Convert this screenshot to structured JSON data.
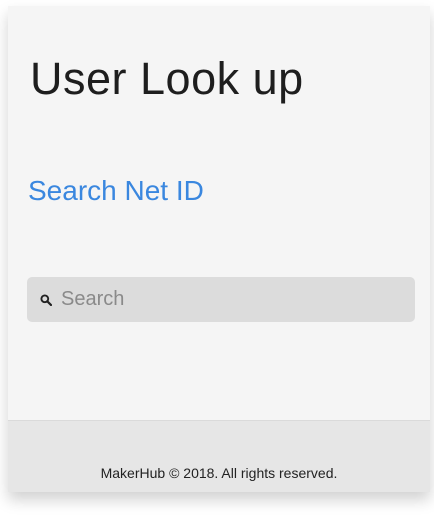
{
  "header": {
    "title": "User Look up"
  },
  "section": {
    "link_label": "Search Net ID"
  },
  "search": {
    "placeholder": "Search",
    "value": "",
    "icon": "search-icon"
  },
  "footer": {
    "copyright": "MakerHub © 2018. All rights reserved."
  },
  "colors": {
    "link": "#3a87df",
    "background": "#f5f5f5",
    "footer_background": "#e6e6e6",
    "search_background": "#dcdcdc"
  }
}
